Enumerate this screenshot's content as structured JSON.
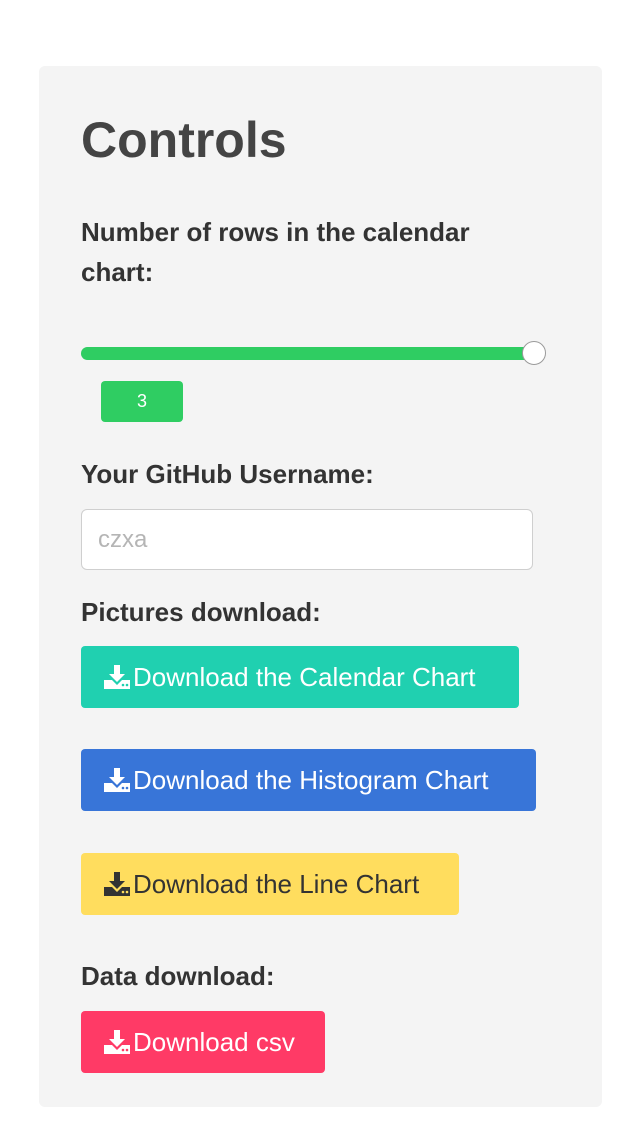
{
  "panel": {
    "title": "Controls"
  },
  "rows_slider": {
    "label": "Number of rows in the calendar chart:",
    "value": "3",
    "fill_fraction": 1.0,
    "fill_color": "#2fcd62"
  },
  "username": {
    "label": "Your GitHub Username:",
    "placeholder": "czxa",
    "value": ""
  },
  "pictures": {
    "label": "Pictures download:",
    "buttons": [
      {
        "label": "Download the Calendar Chart",
        "icon": "download-icon",
        "color": "#20d0b0"
      },
      {
        "label": "Download the Histogram Chart",
        "icon": "download-icon",
        "color": "#3875d8"
      },
      {
        "label": "Download the Line Chart",
        "icon": "download-icon",
        "color": "#ffdd5e"
      }
    ]
  },
  "data_download": {
    "label": "Data download:",
    "button": {
      "label": "Download csv",
      "icon": "download-icon",
      "color": "#ff3a66"
    }
  }
}
